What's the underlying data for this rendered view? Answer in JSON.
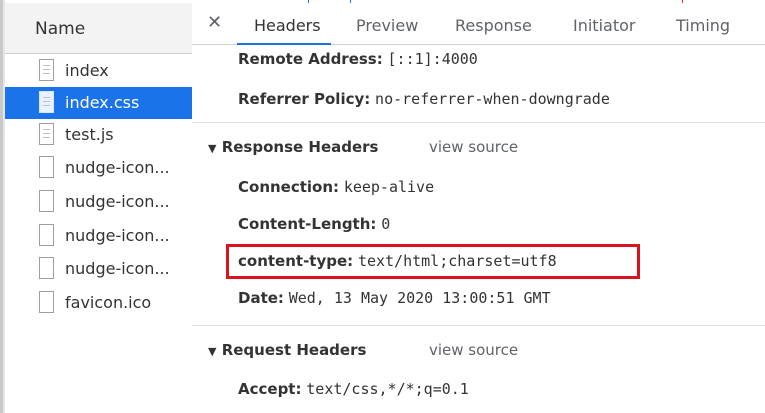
{
  "left_panel": {
    "header": "Name",
    "files": [
      {
        "name": "index",
        "selected": false
      },
      {
        "name": "index.css",
        "selected": true
      },
      {
        "name": "test.js",
        "selected": false
      },
      {
        "name": "nudge-icon...",
        "selected": false
      },
      {
        "name": "nudge-icon...",
        "selected": false
      },
      {
        "name": "nudge-icon...",
        "selected": false
      },
      {
        "name": "nudge-icon...",
        "selected": false
      },
      {
        "name": "favicon.ico",
        "selected": false
      }
    ]
  },
  "tabs": [
    "Headers",
    "Preview",
    "Response",
    "Initiator",
    "Timing"
  ],
  "active_tab": "Headers",
  "general": [
    {
      "key": "Remote Address:",
      "value": "[::1]:4000"
    },
    {
      "key": "Referrer Policy:",
      "value": "no-referrer-when-downgrade"
    }
  ],
  "response_headers": {
    "title": "Response Headers",
    "view_source": "view source",
    "items": [
      {
        "key": "Connection:",
        "value": "keep-alive"
      },
      {
        "key": "Content-Length:",
        "value": "0"
      },
      {
        "key": "content-type:",
        "value": "text/html;charset=utf8"
      },
      {
        "key": "Date:",
        "value": "Wed, 13 May 2020 13:00:51 GMT"
      }
    ]
  },
  "request_headers": {
    "title": "Request Headers",
    "view_source": "view source",
    "items": [
      {
        "key": "Accept:",
        "value": "text/css,*/*;q=0.1"
      }
    ]
  },
  "colors": {
    "accent": "#1a73e8",
    "highlight": "#d9141f"
  }
}
